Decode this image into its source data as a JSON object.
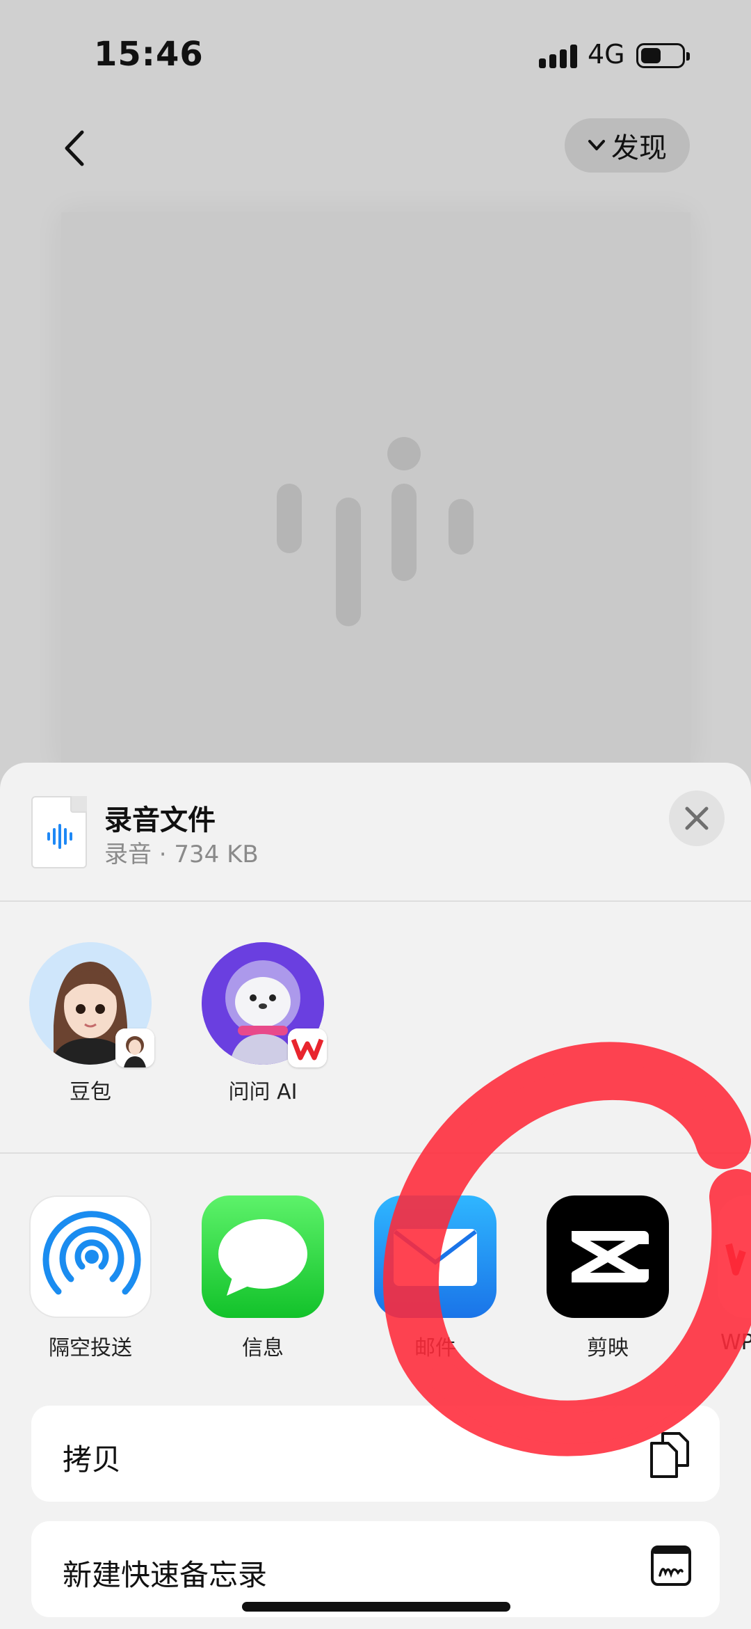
{
  "status_bar": {
    "time": "15:46",
    "network": "4G"
  },
  "nav": {
    "discover_label": "发现"
  },
  "file": {
    "title": "录音文件",
    "subtitle": "录音 · 734 KB"
  },
  "contacts": [
    {
      "name": "豆包"
    },
    {
      "name": "问问 AI"
    }
  ],
  "apps": [
    {
      "name": "隔空投送",
      "icon": "airdrop-icon"
    },
    {
      "name": "信息",
      "icon": "messages-icon"
    },
    {
      "name": "邮件",
      "icon": "mail-icon"
    },
    {
      "name": "剪映",
      "icon": "capcut-icon"
    },
    {
      "name": "WPS",
      "icon": "wps-icon"
    }
  ],
  "actions": [
    {
      "label": "拷贝",
      "icon": "copy-icon"
    },
    {
      "label": "新建快速备忘录",
      "icon": "quick-note-icon"
    }
  ],
  "colors": {
    "sheet_bg": "#f2f2f2",
    "annotation": "#ff2a3a",
    "messages_green": "#34c759",
    "mail_blue": "#1e88f5",
    "airdrop_blue": "#1a8cf0"
  }
}
